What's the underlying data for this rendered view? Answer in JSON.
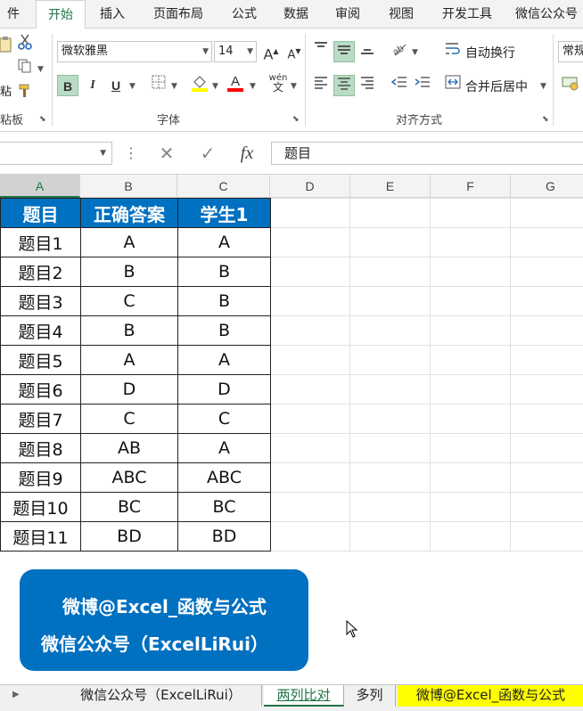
{
  "ribbon_tabs": [
    "件",
    "开始",
    "插入",
    "页面布局",
    "公式",
    "数据",
    "审阅",
    "视图",
    "开发工具",
    "微信公众号"
  ],
  "active_tab": "开始",
  "clipboard": {
    "group_label": "粘板",
    "fragment": "粘"
  },
  "font": {
    "group_label": "字体",
    "font_name": "微软雅黑",
    "font_size": "14",
    "bold": "B",
    "italic": "I",
    "underline": "U",
    "grow": "A",
    "shrink": "A",
    "wen": "wén",
    "wen_char": "文",
    "fill_color": "#ffff00",
    "font_color": "#ff0000"
  },
  "alignment": {
    "group_label": "对齐方式",
    "wrap_text": "自动换行",
    "merge_center": "合并后居中"
  },
  "number": {
    "format": "常规"
  },
  "formula_bar": {
    "cancel": "✕",
    "enter": "✓",
    "fx": "fx",
    "value": "题目",
    "dots": "⋮"
  },
  "columns": [
    "A",
    "B",
    "C",
    "D",
    "E",
    "F",
    "G"
  ],
  "selected_column": "A",
  "table": {
    "headers": [
      "题目",
      "正确答案",
      "学生1"
    ],
    "rows": [
      [
        "题目1",
        "A",
        "A"
      ],
      [
        "题目2",
        "B",
        "B"
      ],
      [
        "题目3",
        "C",
        "B"
      ],
      [
        "题目4",
        "B",
        "B"
      ],
      [
        "题目5",
        "A",
        "A"
      ],
      [
        "题目6",
        "D",
        "D"
      ],
      [
        "题目7",
        "C",
        "C"
      ],
      [
        "题目8",
        "AB",
        "A"
      ],
      [
        "题目9",
        "ABC",
        "ABC"
      ],
      [
        "题目10",
        "BC",
        "BC"
      ],
      [
        "题目11",
        "BD",
        "BD"
      ]
    ]
  },
  "banner": {
    "line1": "微博@Excel_函数与公式",
    "line2": "微信公众号（ExcelLiRui）"
  },
  "sheet_tabs": [
    {
      "label": "微信公众号（ExcelLiRui）",
      "style": "yellow"
    },
    {
      "label": "两列比对",
      "style": "active"
    },
    {
      "label": "多列",
      "style": "normal"
    },
    {
      "label": "微博@Excel_函数与公式",
      "style": "yellow"
    }
  ],
  "colors": {
    "accent": "#217346",
    "header_fill": "#0070c0",
    "tab_highlight": "#ffff00"
  }
}
